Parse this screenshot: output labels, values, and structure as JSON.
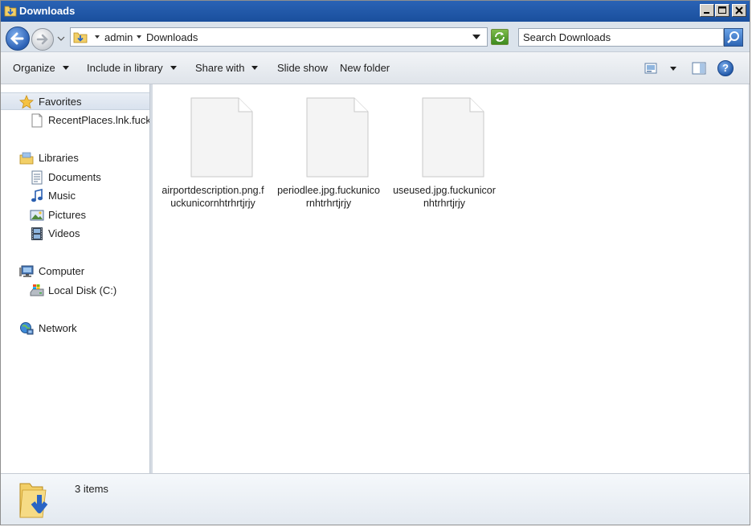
{
  "window": {
    "title": "Downloads"
  },
  "address_bar": {
    "breadcrumbs": [
      "admin",
      "Downloads"
    ],
    "search_placeholder": "Search Downloads"
  },
  "toolbar": {
    "organize": "Organize",
    "include_in_library": "Include in library",
    "share_with": "Share with",
    "slide_show": "Slide show",
    "new_folder": "New folder",
    "help": "?"
  },
  "nav": {
    "favorites": "Favorites",
    "recent_places": "RecentPlaces.lnk.fuckunicornhtrhrtjrjy",
    "libraries": "Libraries",
    "documents": "Documents",
    "music": "Music",
    "pictures": "Pictures",
    "videos": "Videos",
    "computer": "Computer",
    "local_disk": "Local Disk (C:)",
    "network": "Network"
  },
  "files": [
    {
      "name": "airportdescription.png.fuckunicornhtrhrtjrjy"
    },
    {
      "name": "periodlee.jpg.fuckunicornhtrhrtjrjy"
    },
    {
      "name": "useused.jpg.fuckunicornhtrhrtjrjy"
    }
  ],
  "details": {
    "item_count": "3 items"
  },
  "colors": {
    "title_bar": "#1a4f9d",
    "nav_selected": "#d9e2ee",
    "accent": "#2c61b5"
  }
}
